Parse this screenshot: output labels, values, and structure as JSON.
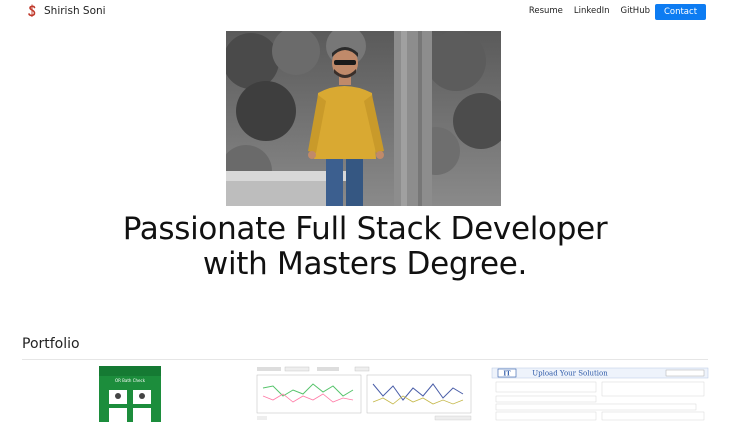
{
  "brand": {
    "name": "Shirish Soni",
    "logo_icon": "s-logo-icon",
    "logo_color": "#c0392b"
  },
  "nav": {
    "links": [
      {
        "label": "Resume"
      },
      {
        "label": "LinkedIn"
      },
      {
        "label": "GitHub"
      }
    ],
    "contact_label": "Contact",
    "accent": "#0d7cf2"
  },
  "hero": {
    "headline": "Passionate Full Stack Developer with Masters Degree."
  },
  "portfolio": {
    "title": "Portfolio",
    "thumbnails": [
      {
        "name": "mobile-app-screenshot",
        "caption": "OR Bath Check"
      },
      {
        "name": "dashboard-charts-screenshot"
      },
      {
        "name": "upload-solution-screenshot",
        "caption": "Upload Your Solution"
      }
    ]
  }
}
